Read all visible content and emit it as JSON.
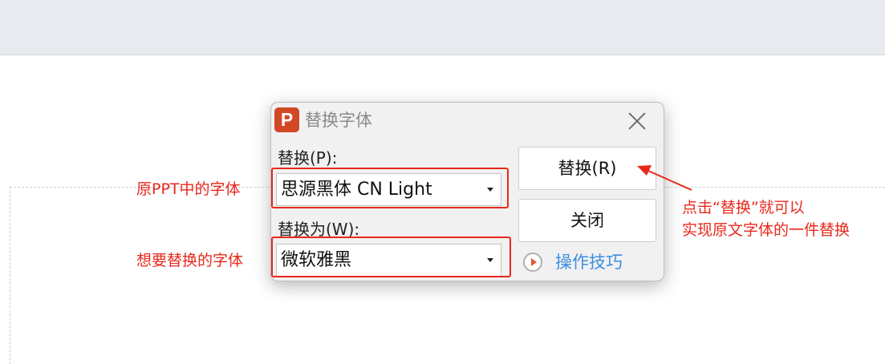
{
  "dialog": {
    "app_icon_letter": "P",
    "title": "替换字体",
    "replace_label": "替换(P):",
    "replace_value": "思源黑体 CN Light",
    "replace_with_label": "替换为(W):",
    "replace_with_value": "微软雅黑",
    "replace_button": "替换(R)",
    "close_button": "关闭",
    "tips_link": "操作技巧"
  },
  "annotations": {
    "original_font": "原PPT中的字体",
    "target_font": "想要替换的字体",
    "hint_line1": "点击“替换”就可以",
    "hint_line2": "实现原文字体的一件替换"
  },
  "colors": {
    "annotation_red": "#e8281c",
    "app_icon": "#d24726",
    "link_blue": "#3e8ee0"
  }
}
